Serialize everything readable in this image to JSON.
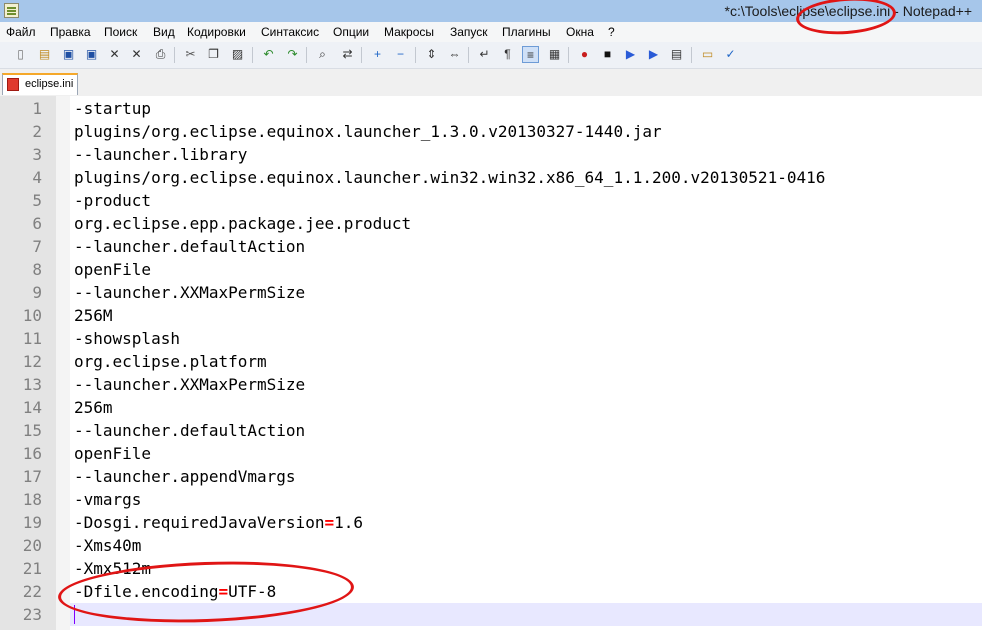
{
  "window": {
    "title": "*c:\\Tools\\eclipse\\eclipse.ini - Notepad++"
  },
  "menu": [
    "Файл",
    "Правка",
    "Поиск",
    "Вид",
    "Кодировки",
    "Синтаксис",
    "Опции",
    "Макросы",
    "Запуск",
    "Плагины",
    "Окна",
    "?"
  ],
  "toolbar": {
    "buttons": [
      {
        "name": "new-file-icon"
      },
      {
        "name": "open-file-icon"
      },
      {
        "name": "save-icon"
      },
      {
        "name": "save-all-icon"
      },
      {
        "name": "close-icon"
      },
      {
        "name": "close-all-icon"
      },
      {
        "name": "print-icon"
      },
      {
        "name": "cut-icon"
      },
      {
        "name": "copy-icon"
      },
      {
        "name": "paste-icon"
      },
      {
        "name": "undo-icon"
      },
      {
        "name": "redo-icon"
      },
      {
        "name": "find-icon"
      },
      {
        "name": "replace-icon"
      },
      {
        "name": "zoom-in-icon"
      },
      {
        "name": "zoom-out-icon"
      },
      {
        "name": "sync-vertical-icon"
      },
      {
        "name": "sync-horizontal-icon"
      },
      {
        "name": "word-wrap-icon"
      },
      {
        "name": "show-all-chars-icon"
      },
      {
        "name": "indent-guide-icon"
      },
      {
        "name": "doc-map-icon"
      },
      {
        "name": "record-macro-icon"
      },
      {
        "name": "stop-record-icon"
      },
      {
        "name": "play-macro-icon"
      },
      {
        "name": "run-macro-multiple-icon"
      },
      {
        "name": "save-macro-icon"
      },
      {
        "name": "folder-workspace-icon"
      },
      {
        "name": "spellcheck-icon"
      }
    ]
  },
  "tabs": [
    {
      "label": "eclipse.ini",
      "active": true
    }
  ],
  "editor": {
    "lines": [
      "-startup",
      "plugins/org.eclipse.equinox.launcher_1.3.0.v20130327-1440.jar",
      "--launcher.library",
      "plugins/org.eclipse.equinox.launcher.win32.win32.x86_64_1.1.200.v20130521-0416",
      "-product",
      "org.eclipse.epp.package.jee.product",
      "--launcher.defaultAction",
      "openFile",
      "--launcher.XXMaxPermSize",
      "256M",
      "-showsplash",
      "org.eclipse.platform",
      "--launcher.XXMaxPermSize",
      "256m",
      "--launcher.defaultAction",
      "openFile",
      "--launcher.appendVmargs",
      "-vmargs",
      "-Dosgi.requiredJavaVersion=1.6",
      "-Xms40m",
      "-Xmx512m",
      "-Dfile.encoding=UTF-8",
      ""
    ],
    "current_line": 23
  },
  "colors": {
    "operator": "#ff0000",
    "annotation": "#e01515",
    "line_number": "#808080",
    "current_line_bg": "#e8e8ff"
  }
}
